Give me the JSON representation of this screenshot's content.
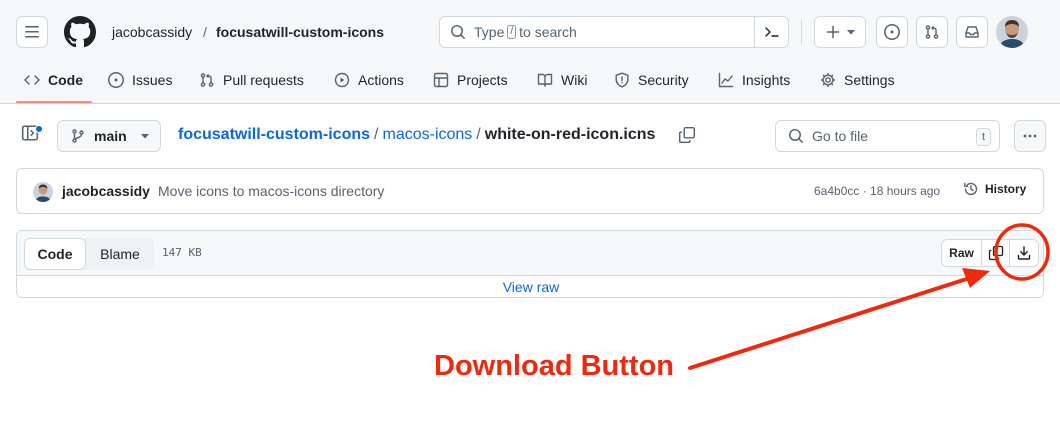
{
  "header": {
    "owner": "jacobcassidy",
    "separator": "/",
    "repo": "focusatwill-custom-icons",
    "search": {
      "prefix": "Type",
      "key": "/",
      "suffix": "to search"
    }
  },
  "tabs": [
    {
      "label": "Code",
      "icon": "code-icon",
      "selected": true
    },
    {
      "label": "Issues",
      "icon": "issue-icon"
    },
    {
      "label": "Pull requests",
      "icon": "pull-request-icon"
    },
    {
      "label": "Actions",
      "icon": "play-icon"
    },
    {
      "label": "Projects",
      "icon": "table-icon"
    },
    {
      "label": "Wiki",
      "icon": "book-icon"
    },
    {
      "label": "Security",
      "icon": "shield-icon"
    },
    {
      "label": "Insights",
      "icon": "graph-icon"
    },
    {
      "label": "Settings",
      "icon": "gear-icon"
    }
  ],
  "file_nav": {
    "branch": "main",
    "path": {
      "repo": "focusatwill-custom-icons",
      "dir": "macos-icons",
      "file": "white-on-red-icon.icns",
      "sep": "/"
    },
    "goto_placeholder": "Go to file",
    "goto_shortcut": "t"
  },
  "commit": {
    "author": "jacobcassidy",
    "message": "Move icons to macos-icons directory",
    "meta": "6a4b0cc · 18 hours ago",
    "history_label": "History"
  },
  "file": {
    "view_code": "Code",
    "view_blame": "Blame",
    "size": "147 KB",
    "raw_label": "Raw",
    "view_raw": "View raw"
  },
  "annotation": {
    "label": "Download Button",
    "color": "#ee2a0e"
  },
  "colors": {
    "link": "#0969da",
    "tab_underline": "#fd8c73",
    "border": "#d1d9e0"
  }
}
